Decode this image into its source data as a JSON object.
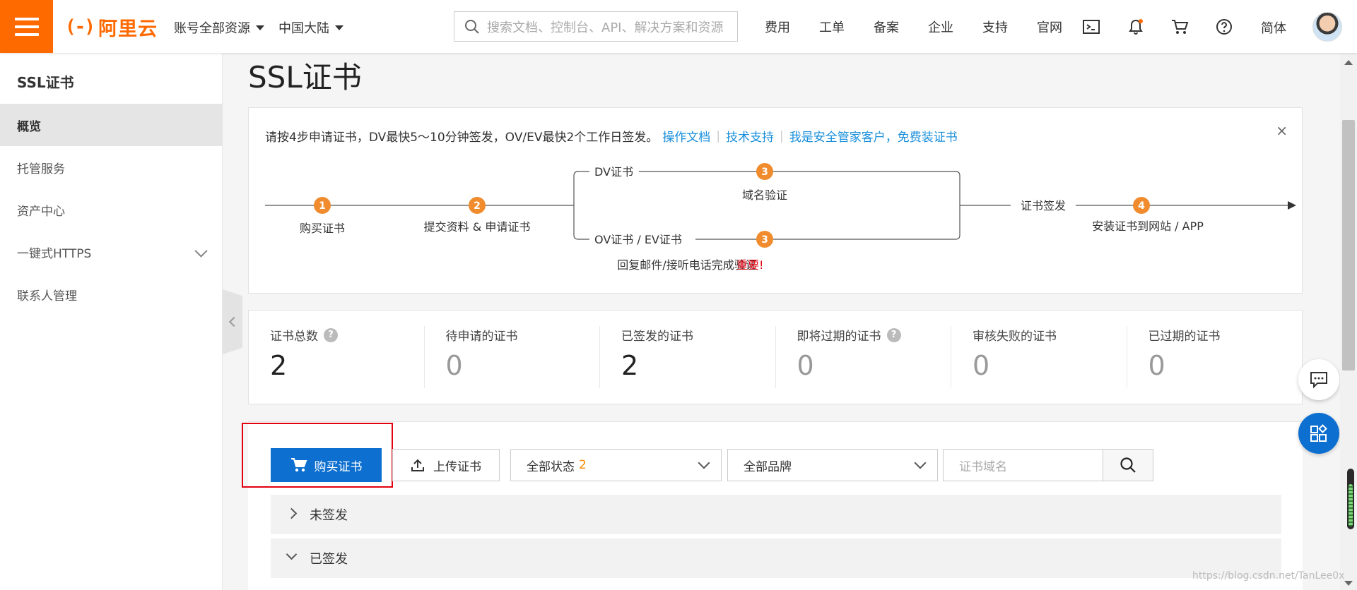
{
  "header": {
    "brand": "阿里云",
    "brand_mark": "(-)",
    "account_scope": "账号全部资源",
    "region": "中国大陆",
    "search_placeholder": "搜索文档、控制台、API、解决方案和资源",
    "nav_links": [
      "费用",
      "工单",
      "备案",
      "企业",
      "支持",
      "官网"
    ],
    "lang": "简体"
  },
  "sidebar": {
    "title": "SSL证书",
    "items": [
      {
        "label": "概览",
        "active": true
      },
      {
        "label": "托管服务"
      },
      {
        "label": "资产中心"
      },
      {
        "label": "一键式HTTPS",
        "expandable": true
      },
      {
        "label": "联系人管理"
      }
    ]
  },
  "page": {
    "title": "SSL证书"
  },
  "notice": {
    "text": "请按4步申请证书，DV最快5～10分钟签发，OV/EV最快2个工作日签发。",
    "links": [
      "操作文档",
      "技术支持",
      "我是安全管家客户，免费装证书"
    ],
    "close": "×",
    "flow": {
      "step1": "购买证书",
      "step2": "提交资料 & 申请证书",
      "dv_label": "DV证书",
      "dv_step": "域名验证",
      "ov_label": "OV证书 / EV证书",
      "ov_step": "回复邮件/接听电话完成验证",
      "important": "重要!",
      "issue_label": "证书签发",
      "step4": "安装证书到网站 / APP",
      "n1": "1",
      "n2": "2",
      "n3": "3",
      "n4": "4"
    }
  },
  "stats": [
    {
      "label": "证书总数",
      "value": "2",
      "help": true
    },
    {
      "label": "待申请的证书",
      "value": "0"
    },
    {
      "label": "已签发的证书",
      "value": "2"
    },
    {
      "label": "即将过期的证书",
      "value": "0",
      "help": true
    },
    {
      "label": "审核失败的证书",
      "value": "0"
    },
    {
      "label": "已过期的证书",
      "value": "0"
    }
  ],
  "toolbar": {
    "buy": "购买证书",
    "upload": "上传证书",
    "status_select": "全部状态",
    "status_count": "2",
    "brand_select": "全部品牌",
    "domain_placeholder": "证书域名"
  },
  "groups": [
    {
      "label": "未签发",
      "expanded": false
    },
    {
      "label": "已签发",
      "expanded": true
    }
  ],
  "watermark": "https://blog.csdn.net/TanLee0x",
  "colors": {
    "accent": "#ff6a00",
    "primary": "#0d6fd0",
    "link": "#1a8fdb",
    "step": "#f08c2e",
    "danger": "#e3000f"
  }
}
